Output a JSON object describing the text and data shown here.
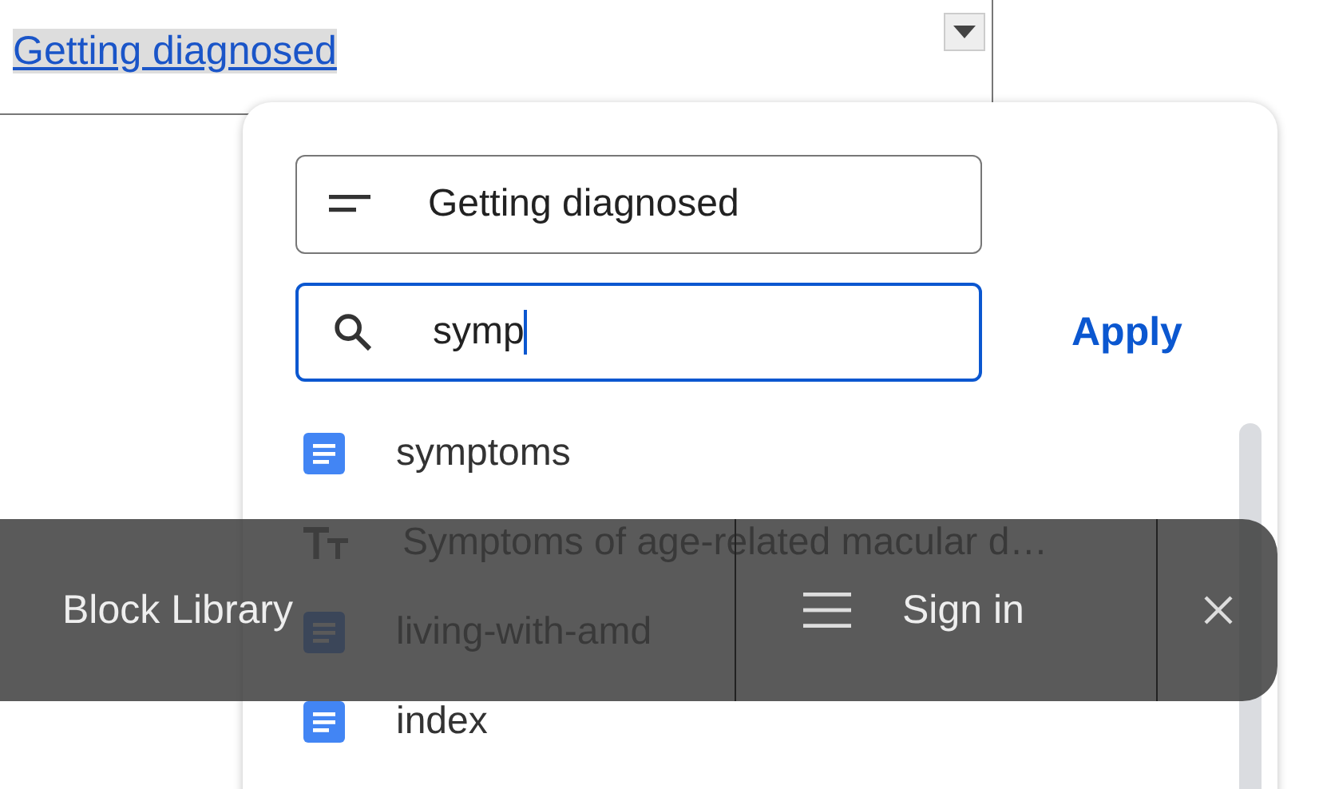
{
  "cell": {
    "link": "Getting diagnosed"
  },
  "link_popup": {
    "text_field": {
      "value": "Getting diagnosed"
    },
    "search_field": {
      "value": "symp"
    },
    "apply": "Apply",
    "results": [
      {
        "kind": "document",
        "label": "symptoms"
      },
      {
        "kind": "heading",
        "label": "Symptoms of age-related macular d…"
      },
      {
        "kind": "document",
        "label": "living-with-amd"
      },
      {
        "kind": "document",
        "label": "index"
      }
    ]
  },
  "toolbar": {
    "title": "Block Library",
    "sign_in": "Sign in"
  }
}
